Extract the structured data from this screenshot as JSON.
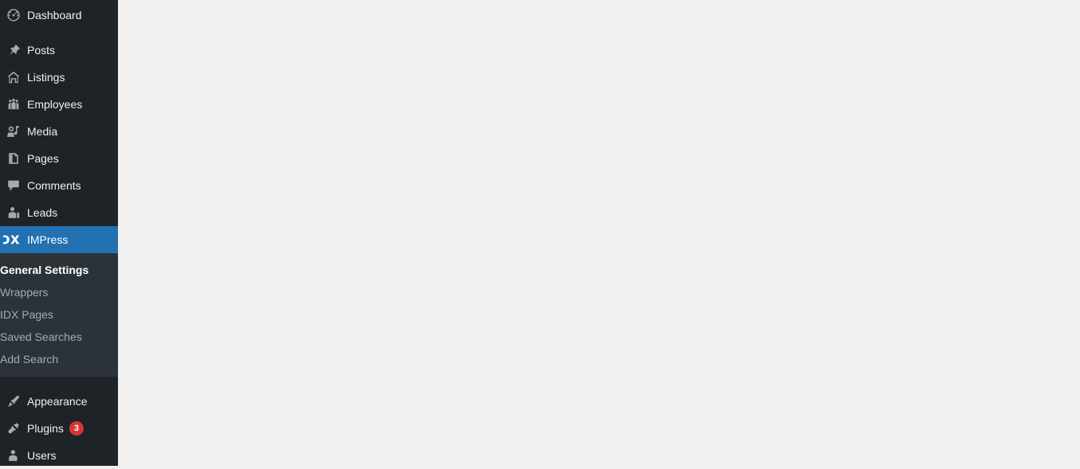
{
  "sidebar": {
    "accent_color": "#2271b1",
    "background_color": "#1d2327",
    "submenu_background_color": "#2c3338",
    "badge_color": "#d63638",
    "items": [
      {
        "label": "Dashboard",
        "icon": "dashboard-gauge-icon",
        "current": false
      },
      {
        "label": "Posts",
        "icon": "pushpin-icon",
        "current": false
      },
      {
        "label": "Listings",
        "icon": "house-icon",
        "current": false
      },
      {
        "label": "Employees",
        "icon": "buddy-group-icon",
        "current": false
      },
      {
        "label": "Media",
        "icon": "media-camera-icon",
        "current": false
      },
      {
        "label": "Pages",
        "icon": "page-document-icon",
        "current": false
      },
      {
        "label": "Comments",
        "icon": "comment-bubble-icon",
        "current": false
      },
      {
        "label": "Leads",
        "icon": "business-user-icon",
        "current": false
      },
      {
        "label": "IMPress",
        "icon": "dx-logo-icon",
        "current": true
      },
      {
        "label": "Appearance",
        "icon": "paintbrush-icon",
        "current": false
      },
      {
        "label": "Plugins",
        "icon": "plug-icon",
        "current": false,
        "badge": "3"
      },
      {
        "label": "Users",
        "icon": "user-icon",
        "current": false
      }
    ],
    "submenu": {
      "parent": "IMPress",
      "items": [
        {
          "label": "General Settings",
          "current": true
        },
        {
          "label": "Wrappers",
          "current": false
        },
        {
          "label": "IDX Pages",
          "current": false
        },
        {
          "label": "Saved Searches",
          "current": false
        },
        {
          "label": "Add Search",
          "current": false
        }
      ]
    }
  },
  "content": {
    "background_color": "#f0f0f1",
    "body_text": ""
  }
}
